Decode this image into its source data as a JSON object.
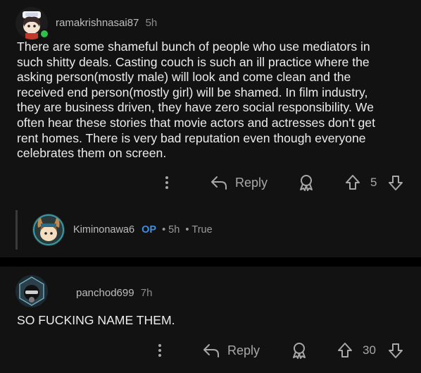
{
  "comments": [
    {
      "username": "ramakrishnasai87",
      "time": "5h",
      "text": "There are some shameful bunch of people who use mediators in such shitty deals. Casting couch is such an ill practice where the asking person(mostly male) will look and come clean and the received end person(mostly girl) will be shamed. In film industry, they are business driven, they have zero social responsibility. We often hear these stories that movie actors and actresses don't get rent homes. There is very bad reputation even though everyone celebrates them on screen.",
      "reply_label": "Reply",
      "votes": "5",
      "avatar_icon": "snoo-avatar-icon"
    },
    {
      "username": "panchod699",
      "time": "7h",
      "text": "SO FUCKING NAME THEM.",
      "reply_label": "Reply",
      "votes": "30",
      "avatar_icon": "snoo-avatar-icon"
    }
  ],
  "collapsed_reply": {
    "username": "Kiminonawa6",
    "op_badge": "OP",
    "time": "5h",
    "separator": "•",
    "flair": "True"
  },
  "colors": {
    "background": "#121212",
    "op_badge": "#3d8fe8",
    "online": "#2fbf4a"
  }
}
